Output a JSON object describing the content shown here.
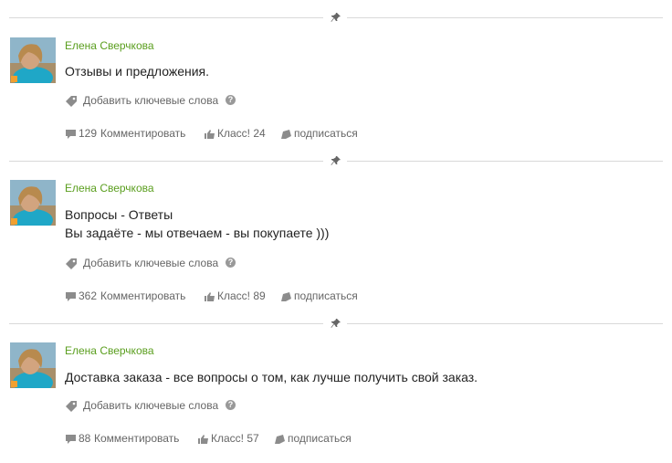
{
  "posts": [
    {
      "author": "Елена Сверчкова",
      "lines": [
        "Отзывы и предложения."
      ],
      "tags_label": "Добавить ключевые слова",
      "comments_count": "129",
      "comment_label": "Комментировать",
      "like_label": "Класс! 24",
      "subscribe_label": "подписаться"
    },
    {
      "author": "Елена Сверчкова",
      "lines": [
        "Вопросы - Ответы",
        "Вы задаёте - мы отвечаем - вы покупаете )))"
      ],
      "tags_label": "Добавить ключевые слова",
      "comments_count": "362",
      "comment_label": "Комментировать",
      "like_label": "Класс! 89",
      "subscribe_label": "подписаться"
    },
    {
      "author": "Елена Сверчкова",
      "lines": [
        "Доставка заказа - все вопросы о том, как лучше получить свой заказ."
      ],
      "tags_label": "Добавить ключевые слова",
      "comments_count": "88",
      "comment_label": "Комментировать",
      "like_label": "Класс! 57",
      "subscribe_label": "подписаться"
    }
  ],
  "colors": {
    "author": "#5a9e1e",
    "meta_text": "#666666",
    "icon": "#8c8c8c",
    "separator": "#d9d9d9"
  },
  "icons": [
    "pin-icon",
    "tag-icon",
    "help-icon",
    "comment-icon",
    "like-icon",
    "subscribe-icon"
  ]
}
